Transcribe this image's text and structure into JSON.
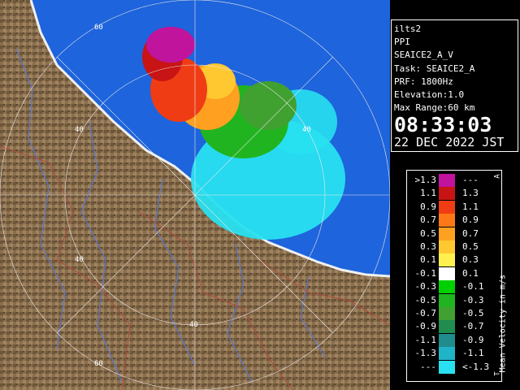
{
  "info": {
    "radar": "ilts2",
    "scan": "PPI",
    "product": "SEAICE2_A_V",
    "task": "Task: SEAICE2_A",
    "prf": "PRF: 1800Hz",
    "elevation": "Elevation:1.0",
    "max_range": "Max Range:60 km",
    "time": "08:33:03",
    "date": "22 DEC 2022 JST"
  },
  "map": {
    "range_labels": [
      "60",
      "40",
      "40",
      "40",
      "40",
      "60"
    ],
    "colors": {
      "sea": "#1e64dc",
      "land": "#8a6f4e",
      "river": "#5a78c8",
      "boundary": "#b04a3a"
    }
  },
  "legend": {
    "title": "Mean Velocity in m/s",
    "corner_top": "A",
    "corner_bottom": "T",
    "rows": [
      {
        "lo": ">1.3",
        "hi": "---",
        "color": "#c0149c"
      },
      {
        "lo": "1.1",
        "hi": "1.3",
        "color": "#c81414"
      },
      {
        "lo": "0.9",
        "hi": "1.1",
        "color": "#f03c14"
      },
      {
        "lo": "0.7",
        "hi": "0.9",
        "color": "#ff7818"
      },
      {
        "lo": "0.5",
        "hi": "0.7",
        "color": "#ffa020"
      },
      {
        "lo": "0.3",
        "hi": "0.5",
        "color": "#ffc830"
      },
      {
        "lo": "0.1",
        "hi": "0.3",
        "color": "#fff050"
      },
      {
        "lo": "-0.1",
        "hi": "0.1",
        "color": "#ffffff"
      },
      {
        "lo": "-0.3",
        "hi": "-0.1",
        "color": "#00d000"
      },
      {
        "lo": "-0.5",
        "hi": "-0.3",
        "color": "#20b420"
      },
      {
        "lo": "-0.7",
        "hi": "-0.5",
        "color": "#40a030"
      },
      {
        "lo": "-0.9",
        "hi": "-0.7",
        "color": "#208c50"
      },
      {
        "lo": "-1.1",
        "hi": "-0.9",
        "color": "#208c8c"
      },
      {
        "lo": "-1.3",
        "hi": "-1.1",
        "color": "#20b4c8"
      },
      {
        "lo": "---",
        "hi": "<-1.3",
        "color": "#28e0f0"
      }
    ]
  }
}
